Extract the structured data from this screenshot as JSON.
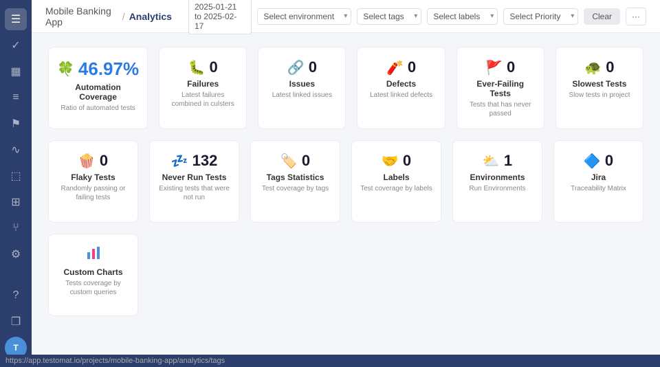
{
  "header": {
    "app_name": "Mobile Banking App",
    "separator": "/",
    "page_name": "Analytics",
    "date_range": "2025-01-21 to 2025-02-17",
    "filter_environment_placeholder": "Select environment",
    "filter_tags_placeholder": "Select tags",
    "filter_labels_placeholder": "Select labels",
    "filter_priority_placeholder": "Select Priority",
    "btn_clear": "Clear",
    "btn_more": "···"
  },
  "sidebar": {
    "icons": [
      {
        "name": "menu-icon",
        "symbol": "☰",
        "active": true
      },
      {
        "name": "check-icon",
        "symbol": "✓",
        "active": false
      },
      {
        "name": "chart-icon",
        "symbol": "📊",
        "active": false
      },
      {
        "name": "list-icon",
        "symbol": "☰",
        "active": false
      },
      {
        "name": "flag-icon",
        "symbol": "⚑",
        "active": false
      },
      {
        "name": "pulse-icon",
        "symbol": "〜",
        "active": false
      },
      {
        "name": "box-icon",
        "symbol": "⬜",
        "active": false
      },
      {
        "name": "grid-icon",
        "symbol": "⊞",
        "active": false
      },
      {
        "name": "branch-icon",
        "symbol": "⑂",
        "active": false
      },
      {
        "name": "settings-icon",
        "symbol": "⚙",
        "active": false
      },
      {
        "name": "help-icon",
        "symbol": "?",
        "active": false
      },
      {
        "name": "pages-icon",
        "symbol": "❐",
        "active": false
      },
      {
        "name": "user-icon",
        "symbol": "●",
        "active": false
      }
    ]
  },
  "row1_cards": [
    {
      "icon": "🍀",
      "value": "46.97%",
      "is_large": true,
      "title": "Automation Coverage",
      "subtitle": "Ratio of automated tests"
    },
    {
      "icon": "🐛",
      "value": "0",
      "is_large": false,
      "title": "Failures",
      "subtitle": "Latest failures combined in culsters"
    },
    {
      "icon": "🔗",
      "value": "0",
      "is_large": false,
      "title": "Issues",
      "subtitle": "Latest linked issues"
    },
    {
      "icon": "🧨",
      "value": "0",
      "is_large": false,
      "title": "Defects",
      "subtitle": "Latest linked defects"
    },
    {
      "icon": "🚩",
      "value": "0",
      "is_large": false,
      "title": "Ever-Failing Tests",
      "subtitle": "Tests that has never passed"
    },
    {
      "icon": "🐢",
      "value": "0",
      "is_large": false,
      "title": "Slowest Tests",
      "subtitle": "Slow tests in project"
    }
  ],
  "row2_cards": [
    {
      "icon": "🍿",
      "value": "0",
      "is_large": false,
      "title": "Flaky Tests",
      "subtitle": "Randomly passing or failing tests"
    },
    {
      "icon": "💤",
      "value": "132",
      "is_large": false,
      "title": "Never Run Tests",
      "subtitle": "Existing tests that were not run"
    },
    {
      "icon": "🏷️",
      "value": "0",
      "is_large": false,
      "title": "Tags Statistics",
      "subtitle": "Test coverage by tags"
    },
    {
      "icon": "🤝",
      "value": "0",
      "is_large": false,
      "title": "Labels",
      "subtitle": "Test coverage by labels"
    },
    {
      "icon": "⛅",
      "value": "1",
      "is_large": false,
      "title": "Environments",
      "subtitle": "Run Environments"
    },
    {
      "icon": "🔷",
      "value": "0",
      "is_large": false,
      "title": "Jira",
      "subtitle": "Traceability Matrix"
    }
  ],
  "row3_cards": [
    {
      "icon": "📊",
      "value": "",
      "is_large": false,
      "title": "Custom Charts",
      "subtitle": "Tests coverage by custom queries",
      "show_bar_icon": true
    }
  ],
  "status_bar": {
    "url": "https://app.testomat.io/projects/mobile-banking-app/analytics/tags"
  }
}
